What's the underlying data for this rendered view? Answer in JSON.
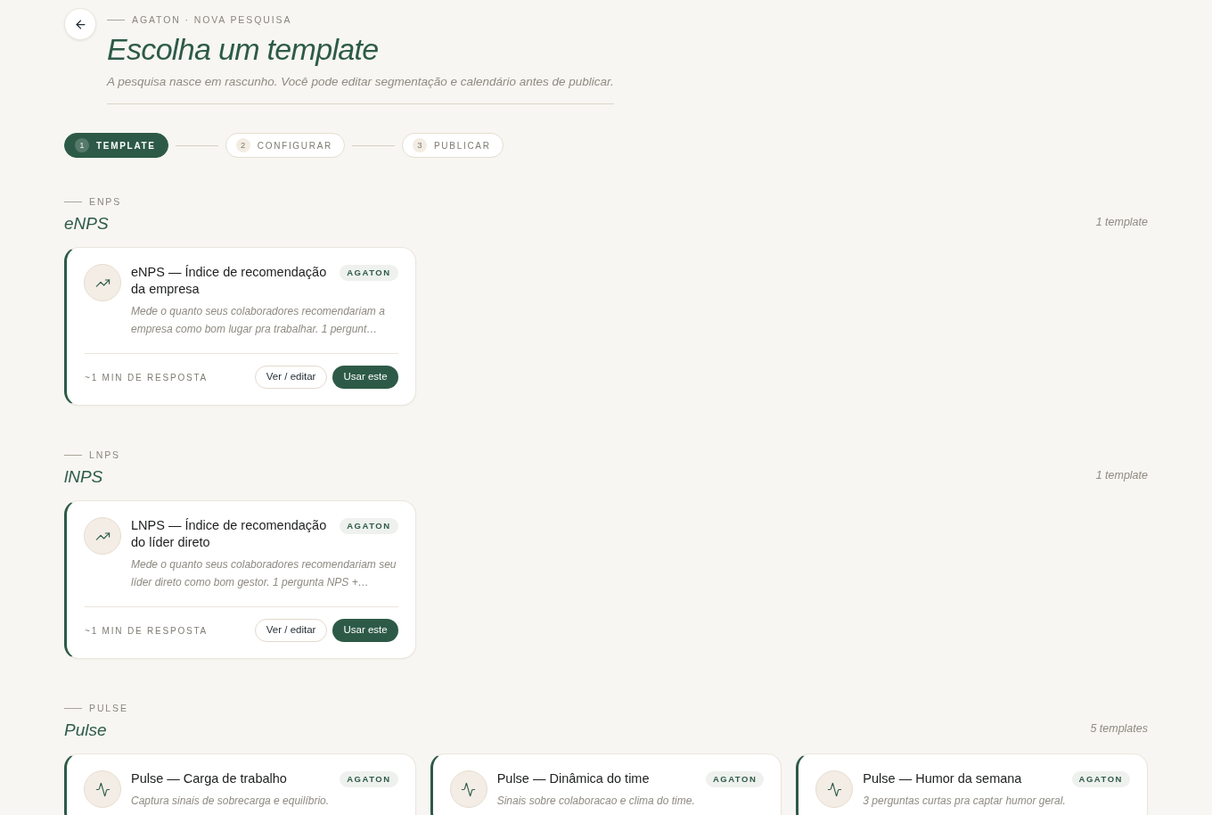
{
  "header": {
    "eyebrow": "AGATON · NOVA PESQUISA",
    "title": "Escolha um template",
    "subtitle": "A pesquisa nasce em rascunho. Você pode editar segmentação e calendário antes de publicar."
  },
  "steps": [
    {
      "number": "1",
      "label": "TEMPLATE",
      "selected": true
    },
    {
      "number": "2",
      "label": "CONFIGURAR",
      "selected": false
    },
    {
      "number": "3",
      "label": "PUBLICAR",
      "selected": false
    }
  ],
  "sections": [
    {
      "eyebrow": "ENPS",
      "title": "eNPS",
      "count": "1 template",
      "templates": [
        {
          "kind": "trend",
          "title": "eNPS — Índice de recomendação da empresa",
          "badge": "AGATON",
          "description": "Mede o quanto seus colaboradores recomendariam a empresa como bom lugar pra trabalhar. 1 pergunt…",
          "duration": "~1 MIN DE RESPOSTA",
          "buttons": [
            "Ver / editar",
            "Usar este"
          ]
        }
      ]
    },
    {
      "eyebrow": "LNPS",
      "title": "lNPS",
      "count": "1 template",
      "templates": [
        {
          "kind": "trend",
          "title": "LNPS — Índice de recomendação do líder direto",
          "badge": "AGATON",
          "description": "Mede o quanto seus colaboradores recomendariam seu líder direto como bom gestor. 1 pergunta NPS +…",
          "duration": "~1 MIN DE RESPOSTA",
          "buttons": [
            "Ver / editar",
            "Usar este"
          ]
        }
      ]
    },
    {
      "eyebrow": "PULSE",
      "title": "Pulse",
      "count": "5 templates",
      "templates": [
        {
          "kind": "pulse",
          "title": "Pulse — Carga de trabalho",
          "badge": "AGATON",
          "description": "Captura sinais de sobrecarga e equilíbrio."
        },
        {
          "kind": "pulse",
          "title": "Pulse — Dinâmica do time",
          "badge": "AGATON",
          "description": "Sinais sobre colaboracao e clima do time."
        },
        {
          "kind": "pulse",
          "title": "Pulse — Humor da semana",
          "badge": "AGATON",
          "description": "3 perguntas curtas pra captar humor geral."
        }
      ]
    }
  ]
}
